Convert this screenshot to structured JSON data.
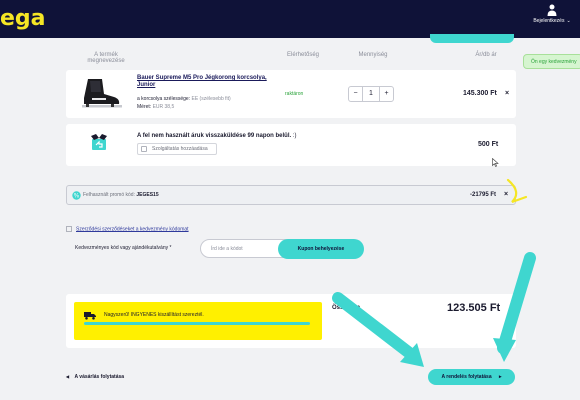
{
  "header": {
    "logo": "ega",
    "login_label": "Bejelentkezés",
    "login_chevron": "⌄",
    "icon": "person-icon"
  },
  "columns": {
    "product": "A termék megnevezése",
    "availability": "Elérhetőség",
    "quantity": "Mennyiség",
    "unit_price": "Ár/db ár"
  },
  "side_badge": "Ön egy kedvezmény",
  "product": {
    "name": "Bauer Supreme M5 Pro Jégkorong korcsolya, Junior",
    "attr1_label": "a korcsolya szélessége:",
    "attr1_value": "EE (szélesebb fit)",
    "attr2_label": "Méret:",
    "attr2_value": "EUR 38,5",
    "stock": "raktáron",
    "qty_minus": "−",
    "qty": "1",
    "qty_plus": "+",
    "price": "145.300 Ft",
    "remove": "×"
  },
  "service": {
    "title": "A fel nem használt áruk visszaküldése 99 napon belül.",
    "title_suffix": ":)",
    "checkbox_label": "Szolgáltatás hozzáadása",
    "price": "500 Ft"
  },
  "promo": {
    "label": "Felhasznált promó kód:",
    "code": "JEGES15",
    "amount": "-21795 Ft",
    "remove": "×"
  },
  "terms_link": "Szerződési szerződéseket a kedvezmény kódomat",
  "coupon": {
    "label": "Kedvezményes kód vagy ajándékutalvány *",
    "placeholder": "Írd ide a kódot",
    "button": "Kupon behelyezése"
  },
  "shipping": {
    "text": "Nagyszerű! INGYENES kiszállítást szereztél.",
    "progress": 1.0
  },
  "total": {
    "label": "Összesen",
    "amount": "123.505 Ft"
  },
  "footer": {
    "back": "A vásárlás folytatása",
    "back_arrow": "◀",
    "order": "A rendelés folytatása",
    "order_arrow": "▸"
  },
  "colors": {
    "navy": "#0f1238",
    "accent": "#3fd6cf",
    "logo": "#f5e625",
    "shipping_bg": "#fff000"
  }
}
